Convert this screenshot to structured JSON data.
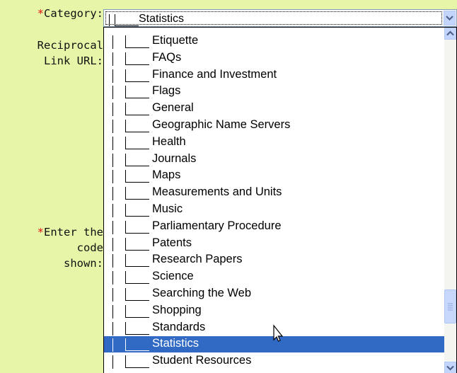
{
  "form": {
    "category_label": "Category:",
    "reciprocal_line1": "Reciprocal",
    "reciprocal_line2": "Link URL:",
    "enter_line1": "Enter the",
    "enter_line2": "code",
    "enter_line3": "shown:",
    "required_marker": "*"
  },
  "select": {
    "value": "Statistics",
    "value_prefix": "| |___"
  },
  "options": [
    "Etiquette",
    "FAQs",
    "Finance and Investment",
    "Flags",
    "General",
    "Geographic Name Servers",
    "Health",
    "Journals",
    "Maps",
    "Measurements and Units",
    "Music",
    "Parliamentary Procedure",
    "Patents",
    "Research Papers",
    "Science",
    "Searching the Web",
    "Shopping",
    "Standards",
    "Statistics",
    "Student Resources"
  ],
  "selected_option": "Statistics",
  "colors": {
    "background": "#e6f5a8",
    "selection": "#316ac5",
    "required": "#e01010"
  },
  "icons": [
    "dropdown-arrow-icon",
    "scroll-up-icon",
    "scroll-down-icon",
    "mouse-pointer-icon"
  ]
}
